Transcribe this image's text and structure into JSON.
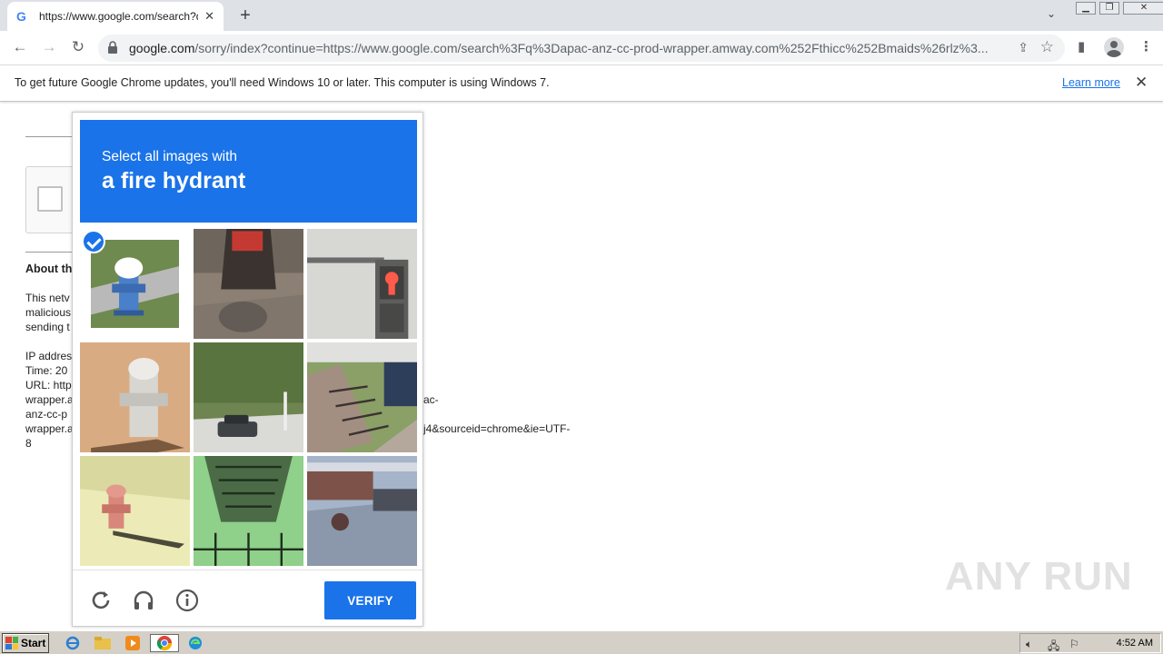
{
  "browser": {
    "tab_title": "https://www.google.com/search?q=",
    "url_host": "google.com",
    "url_rest": "/sorry/index?continue=https://www.google.com/search%3Fq%3Dapac-anz-cc-prod-wrapper.amway.com%252Fthicc%252Bmaids%26rlz%3...",
    "infobar_message": "To get future Google Chrome updates, you'll need Windows 10 or later. This computer is using Windows 7.",
    "infobar_link": "Learn more"
  },
  "page": {
    "about_heading": "About th",
    "paragraph_lines": [
      "This netv",
      "malicious",
      "sending t"
    ],
    "info_lines": [
      "IP addres",
      "Time: 20",
      "URL: http",
      "wrapper.a",
      "anz-cc-p",
      "wrapper.a",
      "8"
    ],
    "info_right_lines": [
      "ac-",
      "j4&sourceid=chrome&ie=UTF-"
    ]
  },
  "captcha": {
    "instruction": "Select all images with",
    "target": "a fire hydrant",
    "verify_label": "VERIFY",
    "tiles": [
      {
        "subject": "fire hydrant",
        "selected": true
      },
      {
        "subject": "person on motorcycle",
        "selected": false
      },
      {
        "subject": "pedestrian signal",
        "selected": false
      },
      {
        "subject": "fire hydrant",
        "selected": false
      },
      {
        "subject": "street with car",
        "selected": false
      },
      {
        "subject": "stairs and bushes",
        "selected": false
      },
      {
        "subject": "fire hydrant",
        "selected": false
      },
      {
        "subject": "fire escape",
        "selected": false
      },
      {
        "subject": "street scene",
        "selected": false
      }
    ]
  },
  "watermark": "ANY RUN",
  "taskbar": {
    "start_label": "Start",
    "clock": "4:52 AM"
  },
  "colors": {
    "captcha_blue": "#1a73e8",
    "chrome_frame": "#dee1e6",
    "taskbar": "#d4d0c8"
  }
}
